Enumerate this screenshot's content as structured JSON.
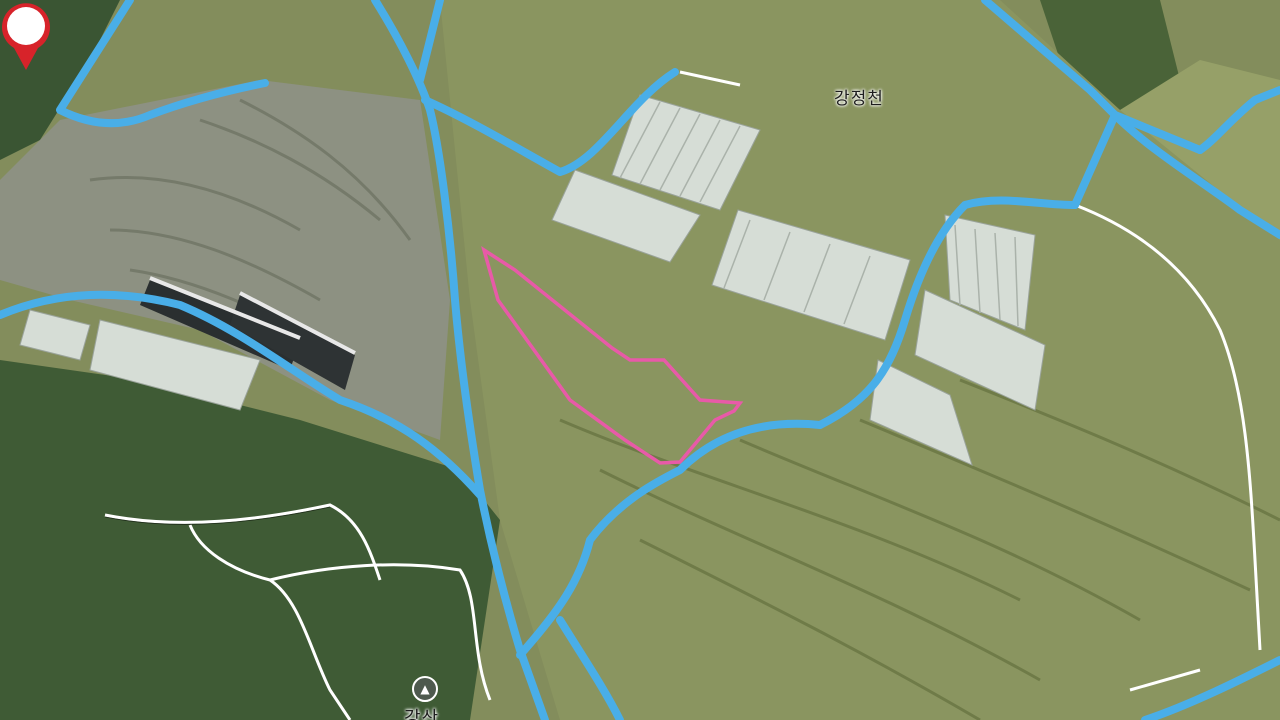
{
  "map": {
    "labels": {
      "stream": "강정천",
      "mountain": "강산"
    },
    "marker": {
      "type": "location-pin",
      "color": "#d7232a"
    },
    "colors": {
      "road_highlight": "#49aee8",
      "road_small": "#ffffff",
      "parcel_outline": "#e85aa8",
      "farmland": "#7f8a58",
      "forest": "#3d5a34",
      "greenhouse": "#d5ddd8"
    },
    "icons": [
      "location-pin-icon",
      "mountain-icon"
    ]
  }
}
